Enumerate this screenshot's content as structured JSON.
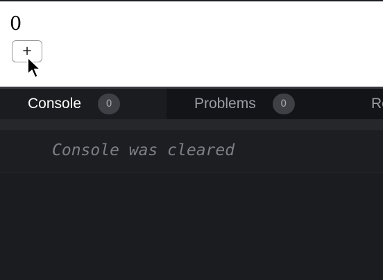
{
  "preview": {
    "counter_value": "0",
    "increment_label": "+"
  },
  "devtools": {
    "tabs": [
      {
        "label": "Console",
        "count": "0",
        "active": true
      },
      {
        "label": "Problems",
        "count": "0",
        "active": false
      },
      {
        "label": "Re",
        "active": false
      }
    ],
    "console": {
      "message": "Console was cleared"
    }
  },
  "colors": {
    "panel_background": "#1b1c1f",
    "tabbar_background": "#131417",
    "active_tab_text": "#ffffff",
    "inactive_tab_text": "#9b9da3",
    "badge_background": "#3e4045",
    "console_message_text": "#7d7f85"
  },
  "icons": {
    "pointer": "mouse-pointer-icon"
  }
}
